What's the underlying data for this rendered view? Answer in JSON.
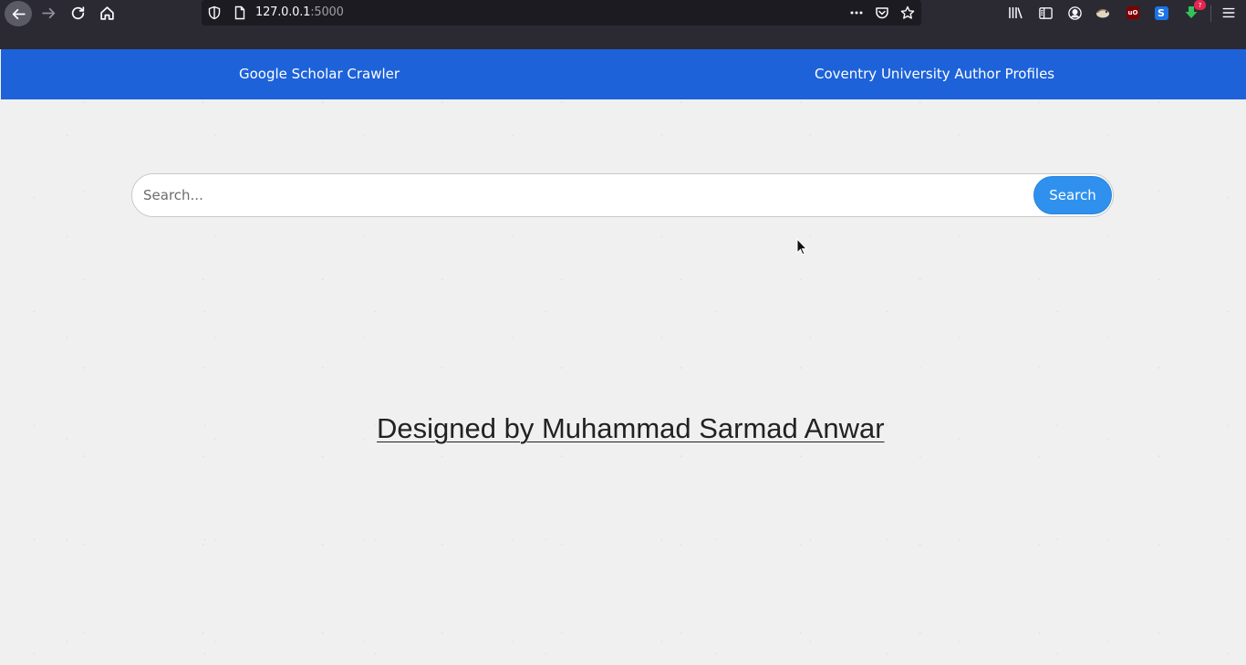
{
  "browser": {
    "url_host": "127.0.0.1",
    "url_port": ":5000"
  },
  "navbar": {
    "links": [
      {
        "label": "Google Scholar Crawler"
      },
      {
        "label": "Coventry University Author Profiles"
      }
    ],
    "color": "#1d62d9"
  },
  "search": {
    "placeholder": "Search...",
    "button_label": "Search",
    "button_color": "#2f91ed"
  },
  "footer": {
    "credit": "Designed by Muhammad Sarmad Anwar"
  },
  "extensions": {
    "download_badge": "?"
  },
  "icons": [
    "back-icon",
    "forward-icon",
    "reload-icon",
    "home-icon",
    "shield-icon",
    "page-icon",
    "more-icon",
    "pocket-icon",
    "star-icon",
    "library-icon",
    "sidebar-icon",
    "account-icon",
    "goose-icon",
    "ublock-icon",
    "s-extension-icon",
    "download-icon",
    "menu-icon"
  ]
}
